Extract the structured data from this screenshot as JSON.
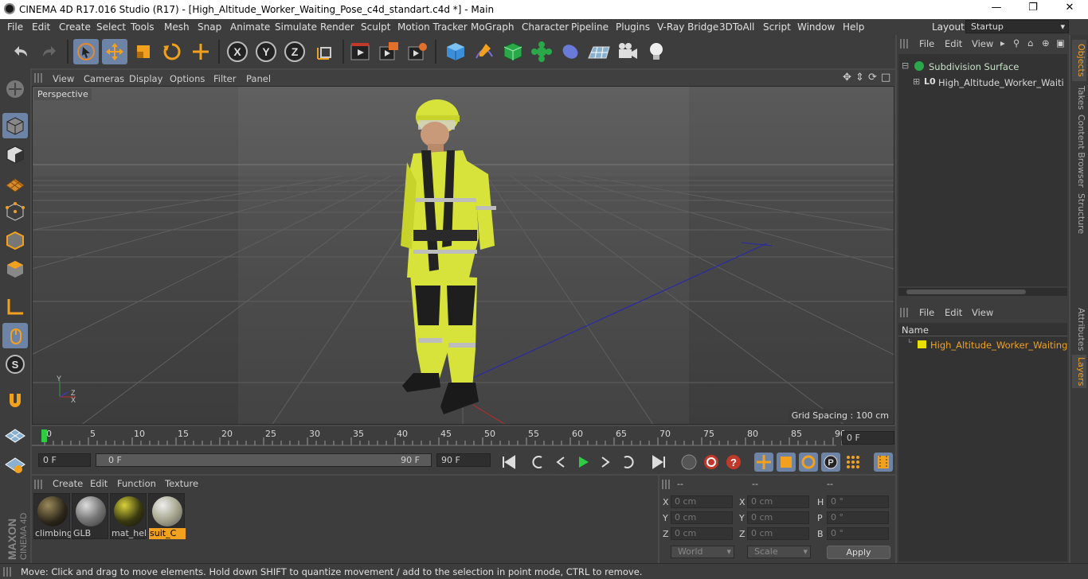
{
  "window": {
    "title": "CINEMA 4D R17.016 Studio (R17) - [High_Altitude_Worker_Waiting_Pose_c4d_standart.c4d *] - Main"
  },
  "menubar": {
    "items": [
      "File",
      "Edit",
      "Create",
      "Select",
      "Tools",
      "Mesh",
      "Snap",
      "Animate",
      "Simulate",
      "Render",
      "Sculpt",
      "Motion Tracker",
      "MoGraph",
      "Character",
      "Pipeline",
      "Plugins",
      "V-Ray Bridge",
      "3DToAll",
      "Script",
      "Window",
      "Help"
    ],
    "layout_label": "Layout:",
    "layout_value": "Startup"
  },
  "viewport": {
    "menu": [
      "View",
      "Cameras",
      "Display",
      "Options",
      "Filter",
      "Panel"
    ],
    "camera_label": "Perspective",
    "grid_spacing": "Grid Spacing : 100 cm"
  },
  "timeline": {
    "ticks": [
      "0",
      "5",
      "10",
      "15",
      "20",
      "25",
      "30",
      "35",
      "40",
      "45",
      "50",
      "55",
      "60",
      "65",
      "70",
      "75",
      "80",
      "85",
      "90"
    ],
    "current_frame": "0 F",
    "start_field": "0 F",
    "slider_start": "0 F",
    "slider_end": "90 F",
    "end_field": "90 F"
  },
  "material_manager": {
    "menu": [
      "Create",
      "Edit",
      "Function",
      "Texture"
    ],
    "materials": [
      {
        "name": "climbing",
        "color": "#3a3220"
      },
      {
        "name": "GLB",
        "color": "#5a5a5a"
      },
      {
        "name": "mat_hel",
        "color": "#2a2a10"
      },
      {
        "name": "suit_C",
        "color": "#b8b8a0"
      }
    ],
    "selected": "suit_C"
  },
  "coordinates": {
    "headers": [
      "--",
      "--",
      "--"
    ],
    "rows": [
      {
        "axis": "X",
        "pos": "0 cm",
        "size_axis": "X",
        "size": "0 cm",
        "rot_axis": "H",
        "rot": "0 °"
      },
      {
        "axis": "Y",
        "pos": "0 cm",
        "size_axis": "Y",
        "size": "0 cm",
        "rot_axis": "P",
        "rot": "0 °"
      },
      {
        "axis": "Z",
        "pos": "0 cm",
        "size_axis": "Z",
        "size": "0 cm",
        "rot_axis": "B",
        "rot": "0 °"
      }
    ],
    "mode_select": "World",
    "scale_select": "Scale",
    "apply_label": "Apply"
  },
  "object_manager": {
    "menu": [
      "File",
      "Edit",
      "View"
    ],
    "objects": [
      {
        "name": "Subdivision Surface"
      },
      {
        "name": "High_Altitude_Worker_Waiting_Pose"
      }
    ]
  },
  "layer_manager": {
    "menu": [
      "File",
      "Edit",
      "View"
    ],
    "column_name": "Name",
    "layers": [
      {
        "name": "High_Altitude_Worker_Waiting_Pose",
        "color": "#e8e000"
      }
    ]
  },
  "side_tabs": [
    "Objects",
    "Takes",
    "Content Browser",
    "Structure",
    "Attributes",
    "Layers"
  ],
  "status": {
    "text": "Move: Click and drag to move elements. Hold down SHIFT to quantize movement / add to the selection in point mode, CTRL to remove."
  },
  "brand": {
    "line1": "MAXON",
    "line2": "CINEMA 4D"
  },
  "colors": {
    "accent": "#6e84a6",
    "selected_material": "#f2a11f",
    "layer_text": "#f2a11f"
  }
}
